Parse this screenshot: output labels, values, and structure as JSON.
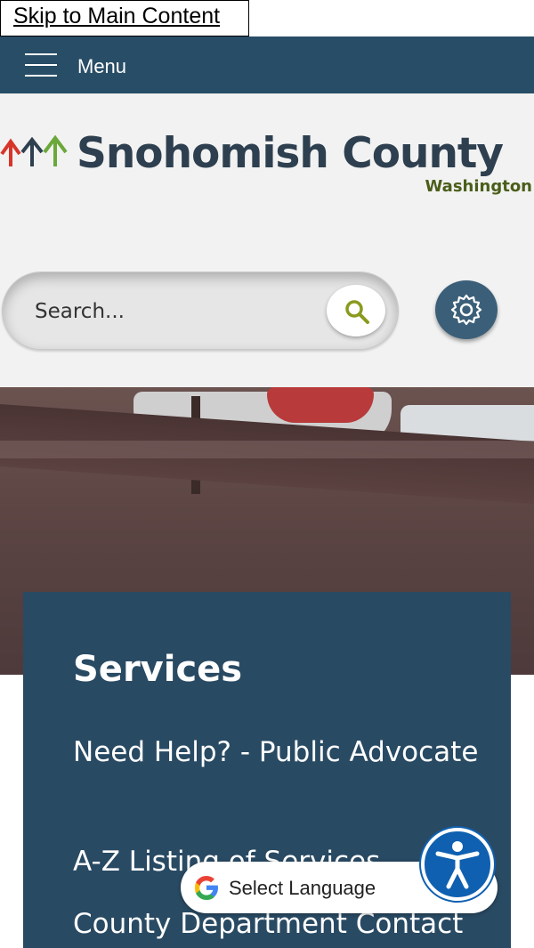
{
  "skip_link": "Skip to Main Content",
  "nav": {
    "menu_label": "Menu"
  },
  "logo": {
    "name": "Snohomish County",
    "subtitle": "Washington"
  },
  "search": {
    "placeholder": "Search..."
  },
  "services": {
    "title": "Services",
    "links": [
      "Need Help? - Public Advocate",
      "A-Z Listing of Services",
      "County Department Contact"
    ]
  },
  "translate": {
    "label": "Select Language"
  },
  "icons": {
    "menu": "hamburger-icon",
    "search": "magnifier-icon",
    "settings": "gear-icon",
    "google": "google-g-icon",
    "dropdown": "chevron-down-icon",
    "accessibility": "accessibility-person-icon"
  },
  "colors": {
    "nav_bar": "#284d66",
    "services_panel": "#294a63",
    "search_icon": "#8a9a1e",
    "gear_button": "#3b5f78",
    "accessibility_button": "#0f60b0"
  }
}
